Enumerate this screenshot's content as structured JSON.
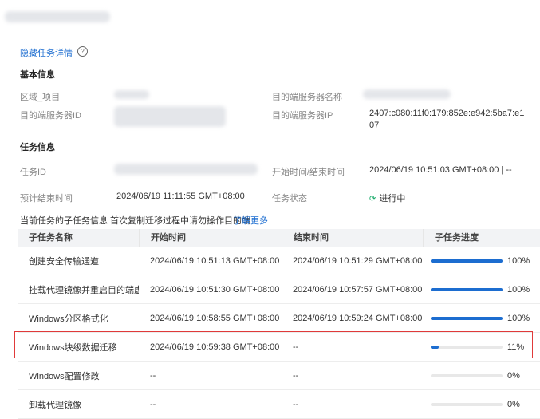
{
  "header": {
    "hide_details_link": "隐藏任务详情",
    "help_glyph": "?"
  },
  "basic": {
    "title": "基本信息",
    "region_label": "区域_项目",
    "target_server_name_label": "目的端服务器名称",
    "target_server_id_label": "目的端服务器ID",
    "target_server_ip_label": "目的端服务器IP",
    "target_server_ip_value": "2407:c080:11f0:179:852e:e942:5ba7:e1",
    "target_server_ip_value_2": "07"
  },
  "task": {
    "title": "任务信息",
    "task_id_label": "任务ID",
    "start_end_label": "开始时间/结束时间",
    "start_end_value": "2024/06/19 10:51:03 GMT+08:00 | --",
    "est_end_label": "预计结束时间",
    "est_end_value": "2024/06/19 11:11:55 GMT+08:00",
    "status_label": "任务状态",
    "status_value": "进行中",
    "status_icon": "sync-icon"
  },
  "subtasks": {
    "info_text": "当前任务的子任务信息  首次复制迁移过程中请勿操作目的端",
    "learn_more": "了解更多",
    "columns": [
      "子任务名称",
      "开始时间",
      "结束时间",
      "子任务进度"
    ],
    "rows": [
      {
        "name": "创建安全传输通道",
        "start": "2024/06/19 10:51:13 GMT+08:00",
        "end": "2024/06/19 10:51:29 GMT+08:00",
        "progress": 100,
        "progress_text": "100%"
      },
      {
        "name": "挂载代理镜像并重启目的端虚拟机",
        "start": "2024/06/19 10:51:30 GMT+08:00",
        "end": "2024/06/19 10:57:57 GMT+08:00",
        "progress": 100,
        "progress_text": "100%"
      },
      {
        "name": "Windows分区格式化",
        "start": "2024/06/19 10:58:55 GMT+08:00",
        "end": "2024/06/19 10:59:24 GMT+08:00",
        "progress": 100,
        "progress_text": "100%"
      },
      {
        "name": "Windows块级数据迁移",
        "start": "2024/06/19 10:59:38 GMT+08:00",
        "end": "--",
        "progress": 11,
        "progress_text": "11%"
      },
      {
        "name": "Windows配置修改",
        "start": "--",
        "end": "--",
        "progress": 0,
        "progress_text": "0%"
      },
      {
        "name": "卸载代理镜像",
        "start": "--",
        "end": "--",
        "progress": 0,
        "progress_text": "0%"
      }
    ]
  },
  "colors": {
    "accent": "#1c6dd0",
    "status_green": "#1aab6b",
    "highlight_red": "#e03a3a"
  }
}
